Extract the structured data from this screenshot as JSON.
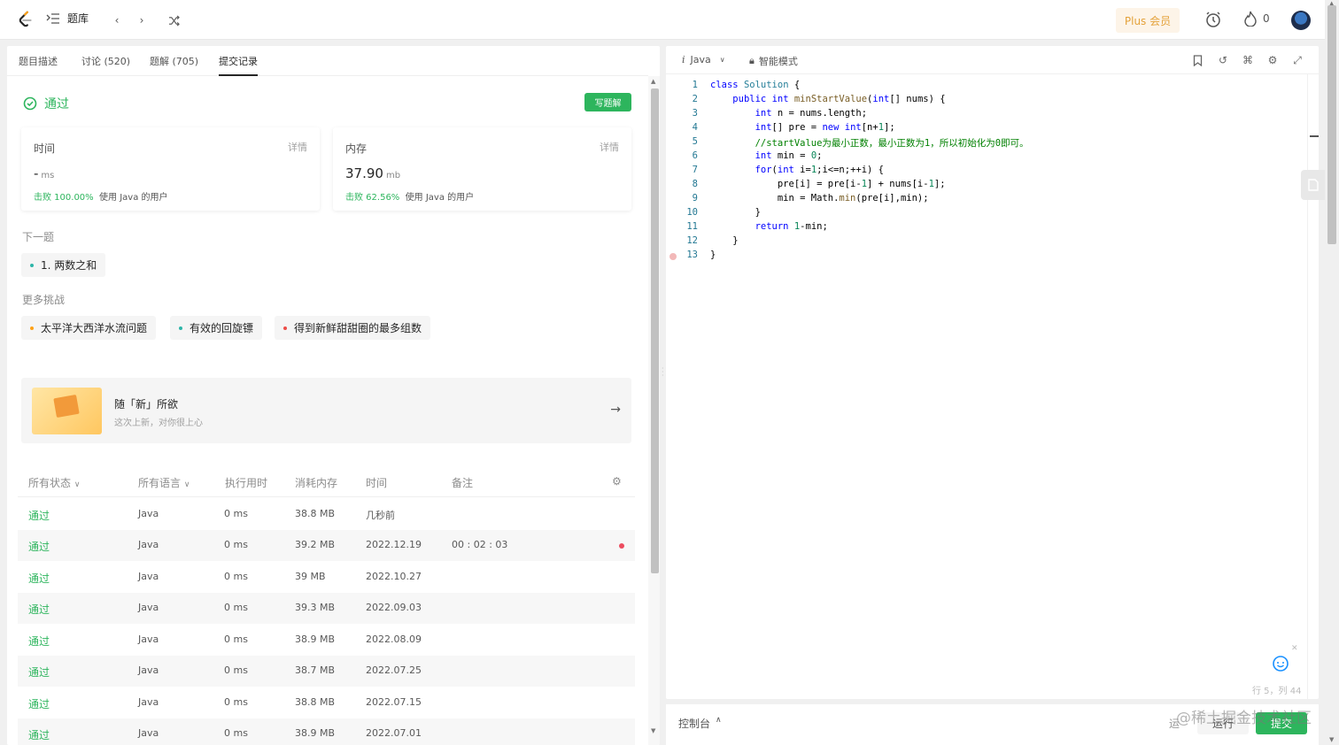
{
  "topbar": {
    "problems_label": "题库",
    "plus_label": "Plus 会员",
    "fire_count": "0"
  },
  "left": {
    "tabs": [
      {
        "label": "题目描述"
      },
      {
        "label": "讨论 (520)"
      },
      {
        "label": "题解 (705)"
      },
      {
        "label": "提交记录"
      }
    ],
    "result": "通过",
    "write_solution": "写题解",
    "time_card": {
      "label": "时间",
      "detail": "详情",
      "value": "-",
      "unit": "ms",
      "beat_prefix": "击败 100.00%",
      "beat_suffix": "使用 Java 的用户"
    },
    "memory_card": {
      "label": "内存",
      "detail": "详情",
      "value": "37.90",
      "unit": "mb",
      "beat_prefix": "击败 62.56%",
      "beat_suffix": "使用 Java 的用户"
    },
    "next_title": "下一题",
    "next_problem": "1. 两数之和",
    "more_title": "更多挑战",
    "challenges": [
      {
        "label": "太平洋大西洋水流问题",
        "color": "#ffa116"
      },
      {
        "label": "有效的回旋镖",
        "color": "#2db5a8"
      },
      {
        "label": "得到新鲜甜甜圈的最多组数",
        "color": "#ec4c47"
      }
    ],
    "promo": {
      "title": "随「新」所欲",
      "subtitle": "这次上新，对你很上心"
    },
    "table_headers": {
      "status": "所有状态",
      "language": "所有语言",
      "runtime": "执行用时",
      "memory": "消耗内存",
      "time": "时间",
      "note": "备注"
    },
    "rows": [
      {
        "status": "通过",
        "language": "Java",
        "runtime": "0 ms",
        "memory": "38.8 MB",
        "time": "几秒前",
        "note": ""
      },
      {
        "status": "通过",
        "language": "Java",
        "runtime": "0 ms",
        "memory": "39.2 MB",
        "time": "2022.12.19",
        "note": "00 : 02 : 03"
      },
      {
        "status": "通过",
        "language": "Java",
        "runtime": "0 ms",
        "memory": "39 MB",
        "time": "2022.10.27",
        "note": ""
      },
      {
        "status": "通过",
        "language": "Java",
        "runtime": "0 ms",
        "memory": "39.3 MB",
        "time": "2022.09.03",
        "note": ""
      },
      {
        "status": "通过",
        "language": "Java",
        "runtime": "0 ms",
        "memory": "38.9 MB",
        "time": "2022.08.09",
        "note": ""
      },
      {
        "status": "通过",
        "language": "Java",
        "runtime": "0 ms",
        "memory": "38.7 MB",
        "time": "2022.07.25",
        "note": ""
      },
      {
        "status": "通过",
        "language": "Java",
        "runtime": "0 ms",
        "memory": "38.8 MB",
        "time": "2022.07.15",
        "note": ""
      },
      {
        "status": "通过",
        "language": "Java",
        "runtime": "0 ms",
        "memory": "38.9 MB",
        "time": "2022.07.01",
        "note": ""
      }
    ]
  },
  "editor": {
    "language": "Java",
    "mode": "智能模式",
    "cursor_position": "行 5，列 44",
    "code_lines": [
      "class Solution {",
      "    public int minStartValue(int[] nums) {",
      "        int n = nums.length;",
      "        int[] pre = new int[n+1];",
      "        //startValue为最小正数，最小正数为1，所以初始化为0即可。",
      "        int min = 0;",
      "        for(int i=1;i<=n;++i) {",
      "            pre[i] = pre[i-1] + nums[i-1];",
      "            min = Math.min(pre[i],min);",
      "        }",
      "        return 1-min;",
      "    }",
      "}"
    ]
  },
  "console": {
    "label": "控制台",
    "lead": "运",
    "run": "运行",
    "submit": "提交",
    "watermark": "@稀土掘金技术社区"
  }
}
